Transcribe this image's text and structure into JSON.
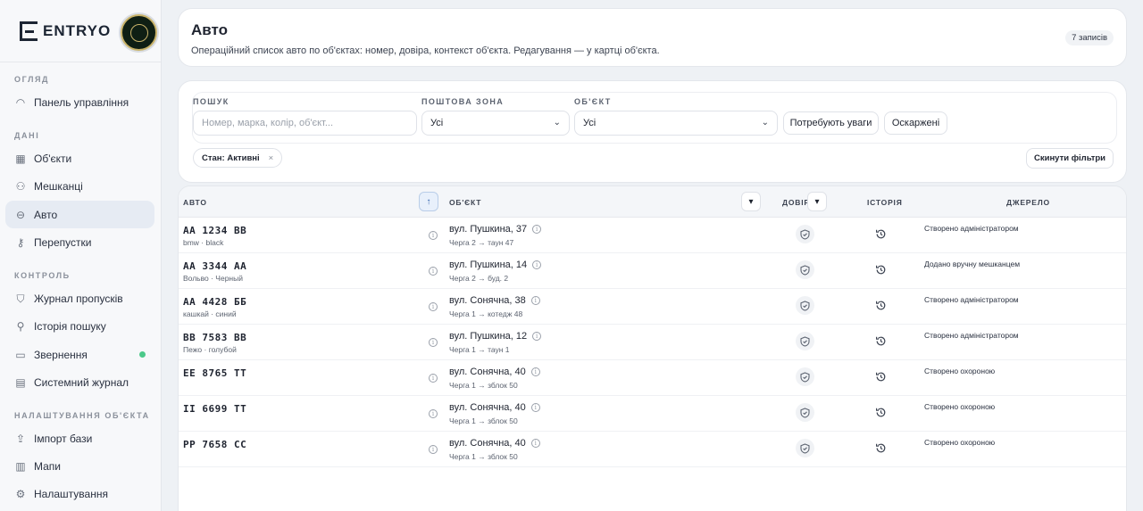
{
  "brand": {
    "name": "ENTRYO"
  },
  "sidebar": {
    "sections": [
      {
        "label": "ОГЛЯД",
        "items": [
          {
            "label": "Панель управління",
            "icon": "gauge-icon"
          }
        ]
      },
      {
        "label": "ДАНІ",
        "items": [
          {
            "label": "Об'єкти",
            "icon": "building-icon"
          },
          {
            "label": "Мешканці",
            "icon": "users-icon"
          },
          {
            "label": "Авто",
            "icon": "car-icon",
            "active": true
          },
          {
            "label": "Перепустки",
            "icon": "key-icon"
          }
        ]
      },
      {
        "label": "КОНТРОЛЬ",
        "items": [
          {
            "label": "Журнал пропусків",
            "icon": "shield-icon"
          },
          {
            "label": "Історія пошуку",
            "icon": "search-icon"
          },
          {
            "label": "Звернення",
            "icon": "message-icon",
            "dot": true
          },
          {
            "label": "Системний журнал",
            "icon": "document-icon"
          }
        ]
      },
      {
        "label": "НАЛАШТУВАННЯ ОБ'ЄКТА",
        "items": [
          {
            "label": "Імпорт бази",
            "icon": "upload-icon"
          },
          {
            "label": "Мапи",
            "icon": "map-icon"
          },
          {
            "label": "Налаштування",
            "icon": "gear-icon"
          }
        ]
      }
    ]
  },
  "header": {
    "title": "Авто",
    "subtitle": "Операційний список авто по об'єктах: номер, довіра, контекст об'єкта. Редагування — у картці об'єкта.",
    "count": "7 записів"
  },
  "filters": {
    "search_label": "ПОШУК",
    "search_placeholder": "Номер, марка, колір, об'єкт...",
    "zone_label": "ПОШТОВА ЗОНА",
    "zone_value": "Усі",
    "object_label": "ОБ'ЄКТ",
    "object_value": "Усі",
    "attention_btn": "Потребують уваги",
    "appealed_btn": "Оскаржені",
    "chip": "Стан: Активні",
    "chip_close": "×",
    "reset_btn": "Скинути фільтри"
  },
  "table": {
    "columns": {
      "car": "АВТО",
      "object": "ОБ'ЄКТ",
      "trust": "ДОВІРА",
      "history": "ІСТОРІЯ",
      "source": "ДЖЕРЕЛО"
    },
    "sort_car": "↑",
    "sort_obj": "▾",
    "sort_trust": "▾",
    "rows": [
      {
        "plate": "AA 1234 BB",
        "car": "bmw · black",
        "address": "вул. Пушкина, 37",
        "route": "Черга 2 → таун 47",
        "source": "Створено адміністратором"
      },
      {
        "plate": "AA 3344 AA",
        "car": "Вольво · Черный",
        "address": "вул. Пушкина, 14",
        "route": "Черга 2 → буд. 2",
        "source": "Додано вручну мешканцем"
      },
      {
        "plate": "AA 4428 ББ",
        "car": "кашкай · синий",
        "address": "вул. Сонячна, 38",
        "route": "Черга 1 → котедж 48",
        "source": "Створено адміністратором"
      },
      {
        "plate": "BB 7583 BB",
        "car": "Пежо · голубой",
        "address": "вул. Пушкина, 12",
        "route": "Черга 1 → таун 1",
        "source": "Створено адміністратором"
      },
      {
        "plate": "EE 8765 TT",
        "car": "",
        "address": "вул. Сонячна, 40",
        "route": "Черга 1 → зблок 50",
        "source": "Створено охороною"
      },
      {
        "plate": "II 6699 TT",
        "car": "",
        "address": "вул. Сонячна, 40",
        "route": "Черга 1 → зблок 50",
        "source": "Створено охороною"
      },
      {
        "plate": "PP 7658 CC",
        "car": "",
        "address": "вул. Сонячна, 40",
        "route": "Черга 1 → зблок 50",
        "source": "Створено охороною"
      }
    ]
  }
}
